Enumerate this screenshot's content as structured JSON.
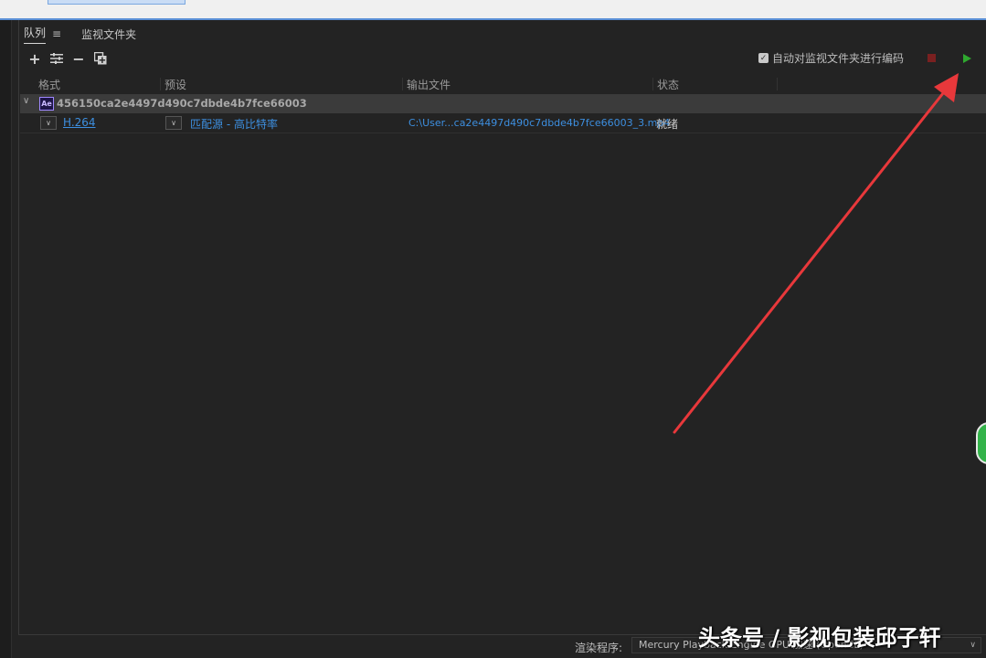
{
  "tabs": {
    "queue_label": "队列",
    "queue_menu": "≡",
    "watch_label": "监视文件夹"
  },
  "toolbar": {
    "add": "+",
    "settings": "⇶",
    "remove": "−",
    "duplicate": "❐"
  },
  "options": {
    "auto_encode_label": "自动对监视文件夹进行编码",
    "auto_encode_checked": true
  },
  "columns": {
    "format": "格式",
    "preset": "预设",
    "output": "输出文件",
    "status": "状态"
  },
  "queue": {
    "group_name": "456150ca2e4497d490c7dbde4b7fce66003",
    "app_badge": "Ae",
    "item": {
      "format": "H.264",
      "preset": "匹配源 - 高比特率",
      "output": "C:\\User...ca2e4497d490c7dbde4b7fce66003_3.mp4",
      "status": "就绪"
    }
  },
  "footer": {
    "renderer_label": "渲染程序:",
    "renderer_value": "Mercury Playback Engine GPU 加速 (OpenCL)"
  },
  "watermark": "头条号 / 影视包装邱子轩",
  "colors": {
    "link": "#3d8fe0",
    "annotation_arrow": "#e8383b",
    "start_button": "#2fa82f",
    "stop_button": "#7a2020"
  }
}
